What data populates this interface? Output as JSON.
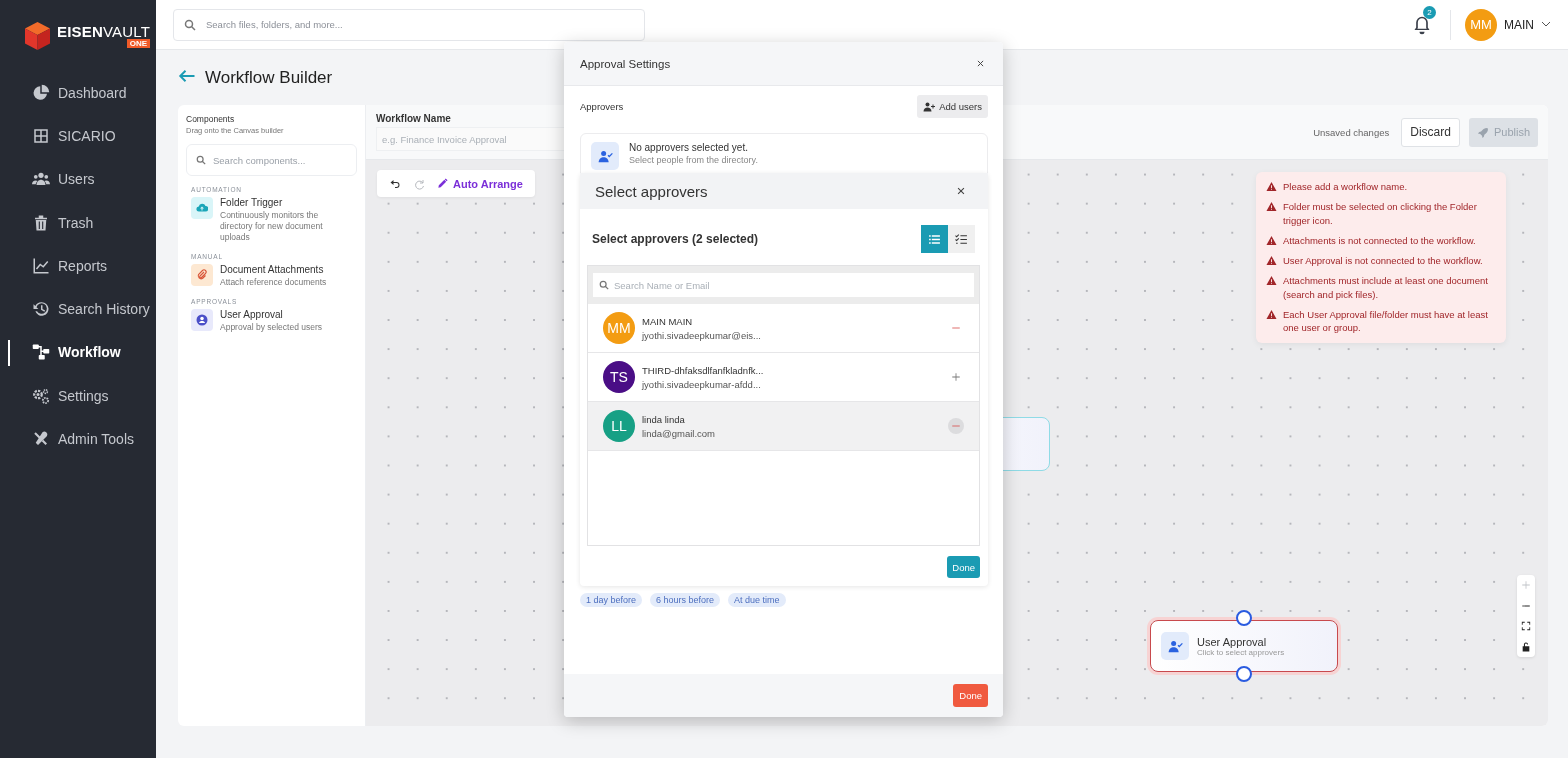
{
  "sidebar": {
    "logo": {
      "text": "**EISEN**VAULT",
      "badge": "ONE"
    },
    "items": [
      {
        "kind": "dashboard",
        "label": "Dashboard",
        "selected": false
      },
      {
        "kind": "grid",
        "label": "SICARIO",
        "selected": false
      },
      {
        "kind": "users",
        "label": "Users",
        "selected": false
      },
      {
        "kind": "trash",
        "label": "Trash",
        "selected": false
      },
      {
        "kind": "reports",
        "label": "Reports",
        "selected": false
      },
      {
        "kind": "history",
        "label": "Search History",
        "selected": false
      },
      {
        "kind": "workflow",
        "label": "Workflow",
        "selected": true
      },
      {
        "kind": "settings",
        "label": "Settings",
        "selected": false
      },
      {
        "kind": "tools",
        "label": "Admin Tools",
        "selected": false
      }
    ]
  },
  "topbar": {
    "search_placeholder": "Search files, folders, and more...",
    "notifications": "2",
    "user": {
      "initials": "MM",
      "name": "MAIN"
    }
  },
  "page": {
    "title": "Workflow Builder"
  },
  "components": {
    "title": "Components",
    "subtitle": "Drag onto the Canvas builder",
    "search_placeholder": "Search components...",
    "groups": [
      {
        "label": "AUTOMATION",
        "items": [
          {
            "kind": "trigger",
            "name": "Folder Trigger",
            "description": "Continuously monitors the directory for new document uploads"
          }
        ]
      },
      {
        "label": "MANUAL",
        "items": [
          {
            "kind": "attachments",
            "name": "Document Attachments",
            "description": "Attach reference documents"
          }
        ]
      },
      {
        "label": "APPROVALS",
        "items": [
          {
            "kind": "approval",
            "name": "User Approval",
            "description": "Approval by selected users"
          }
        ]
      }
    ]
  },
  "header": {
    "name_label": "Workflow Name",
    "name_placeholder": "e.g. Finance Invoice Approval",
    "status": "Unsaved changes",
    "discard": "Discard",
    "publish": {
      "label": "Publish",
      "disabled": true
    }
  },
  "canvas": {
    "toolbar": [
      {
        "kind": "undo",
        "disabled": false
      },
      {
        "kind": "redo",
        "disabled": true
      },
      {
        "kind": "auto-arrange",
        "label": "Auto Arrange",
        "disabled": false
      }
    ],
    "errors": [
      "Please add a workflow name.",
      "Folder must be selected on clicking the Folder trigger icon.",
      "Attachments is not connected to the workflow.",
      "User Approval is not connected to the workflow.",
      "Attachments must include at least one document (search and pick files).",
      "Each User Approval file/folder must have at least one user or group."
    ],
    "nodes": [
      {
        "kind": "trigger",
        "invalid": false
      },
      {
        "kind": "approval",
        "title": "User Approval",
        "subtitle": "Click to select approvers",
        "invalid": true
      }
    ],
    "zoom_controls": [
      {
        "kind": "zoom-in",
        "disabled": true
      },
      {
        "kind": "zoom-out",
        "disabled": false
      },
      {
        "kind": "fit",
        "disabled": false
      },
      {
        "kind": "lock",
        "disabled": false
      }
    ]
  },
  "modal": {
    "title": "Approval Settings",
    "approvers_label": "Approvers",
    "add_users": "Add users",
    "empty": {
      "title": "No approvers selected yet.",
      "hint": "Select people from the directory."
    },
    "chips": [
      "1 day before",
      "6 hours before",
      "At due time"
    ],
    "done": "Done",
    "picker": {
      "title": "Select approvers",
      "count_label": "Select approvers (2 selected)",
      "views": [
        {
          "kind": "list",
          "selected": true
        },
        {
          "kind": "checklist",
          "selected": false
        }
      ],
      "search_placeholder": "Search Name or Email",
      "people": [
        {
          "initials": "MM",
          "name": "MAIN MAIN",
          "email": "jyothi.sivadeepkumar@eis...",
          "color": "#f39c12",
          "selected": true,
          "hovered": false
        },
        {
          "initials": "TS",
          "name": "THIRD-dhfaksdlfanfkladnfk...",
          "email": "jyothi.sivadeepkumar-afdd...",
          "color": "#4a0e86",
          "selected": false,
          "hovered": false
        },
        {
          "initials": "LL",
          "name": "linda linda",
          "email": "linda@gmail.com",
          "color": "#17a085",
          "selected": true,
          "hovered": true
        }
      ],
      "done": "Done"
    }
  }
}
